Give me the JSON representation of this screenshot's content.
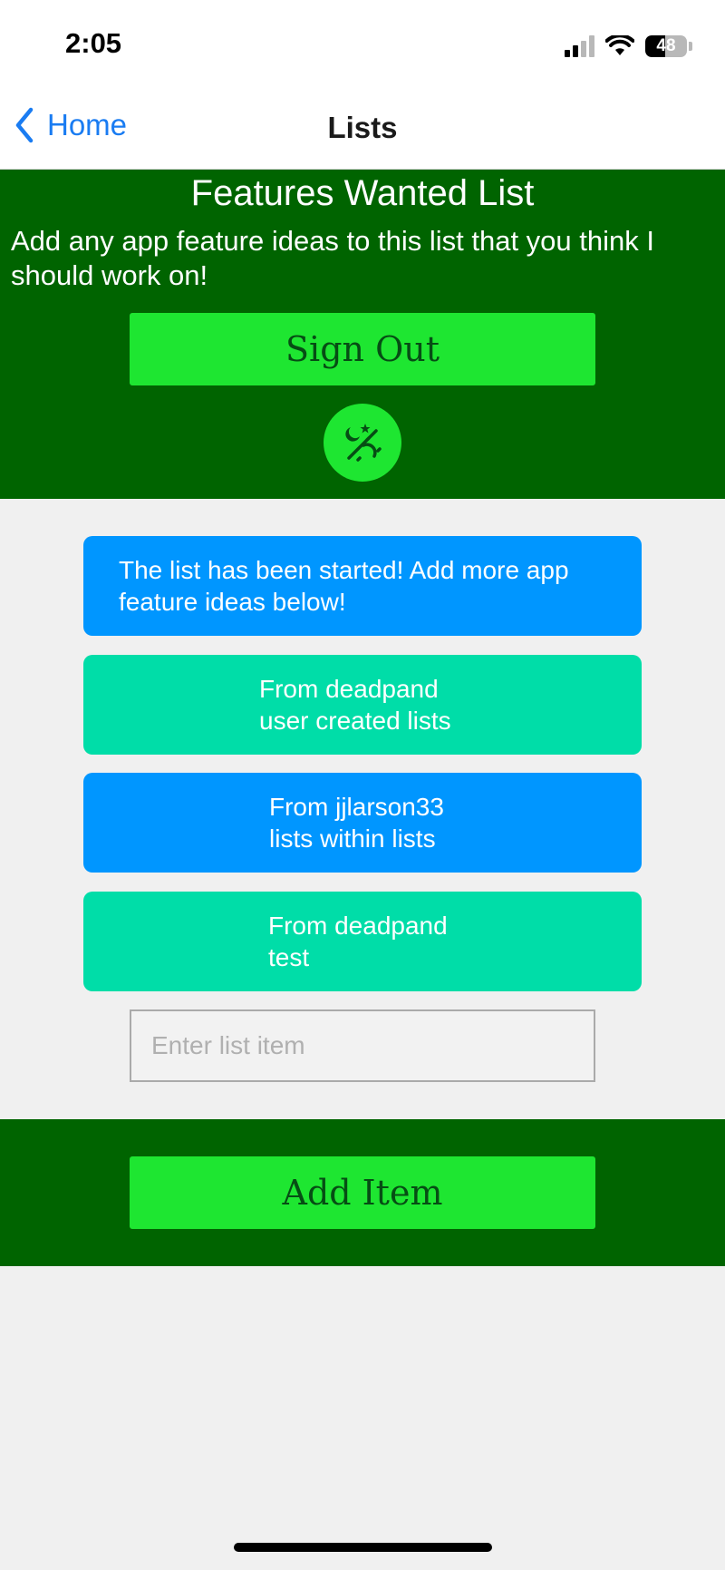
{
  "status_bar": {
    "time": "2:05",
    "battery_level": "48",
    "signal_bars": 2,
    "signal_icon": "cellular-signal-icon",
    "wifi_icon": "wifi-icon",
    "battery_icon": "battery-icon"
  },
  "nav": {
    "back_label": "Home",
    "back_icon": "chevron-left-icon",
    "title": "Lists"
  },
  "header": {
    "title": "Features Wanted List",
    "description": "Add any app feature ideas to this list that you think I should work on!",
    "signout_label": "Sign Out",
    "theme_toggle_icon": "theme-toggle-icon"
  },
  "items": [
    {
      "text": "The list has been started! Add more app feature ideas below!"
    },
    {
      "text": "From deadpand\nuser created lists"
    },
    {
      "text": "From jjlarson33\nlists within lists"
    },
    {
      "text": "From deadpand\ntest"
    }
  ],
  "input": {
    "placeholder": "Enter list item",
    "value": ""
  },
  "footer": {
    "add_label": "Add Item"
  },
  "colors": {
    "dark_green": "#006400",
    "bright_green": "#1ee631",
    "button_text": "#064d14",
    "card_blue": "#0096ff",
    "card_teal": "#00dda8",
    "link_blue": "#1a7cf2",
    "background": "#f0f0f0"
  }
}
